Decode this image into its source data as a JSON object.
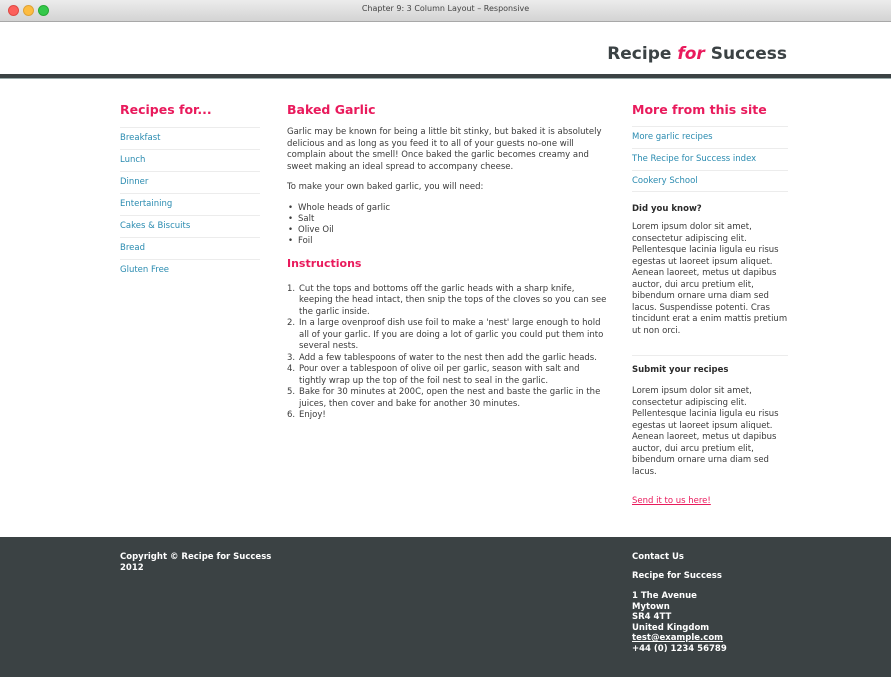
{
  "window": {
    "title": "Chapter 9: 3 Column Layout – Responsive"
  },
  "header": {
    "logo_part1": "Recipe ",
    "logo_part2": "for",
    "logo_part3": " Success"
  },
  "left": {
    "heading": "Recipes for...",
    "items": [
      "Breakfast",
      "Lunch",
      "Dinner",
      "Entertaining",
      "Cakes & Biscuits",
      "Bread",
      "Gluten Free"
    ]
  },
  "main": {
    "title": "Baked Garlic",
    "intro": "Garlic may be known for being a little bit stinky, but baked it is absolutely delicious and as long as you feed it to all of your guests no-one will complain about the smell! Once baked the garlic becomes creamy and sweet making an ideal spread to accompany cheese.",
    "need": "To make your own baked garlic, you will need:",
    "ingredients": [
      "Whole heads of garlic",
      "Salt",
      "Olive Oil",
      "Foil"
    ],
    "instructions_heading": "Instructions",
    "steps": [
      "Cut the tops and bottoms off the garlic heads with a sharp knife, keeping the head intact, then snip the tops of the cloves so you can see the garlic inside.",
      "In a large ovenproof dish use foil to make a 'nest' large enough to hold all of your garlic. If you are doing a lot of garlic you could put them into several nests.",
      "Add a few tablespoons of water to the nest then add the garlic heads.",
      "Pour over a tablespoon of olive oil per garlic, season with salt and tightly wrap up the top of the foil nest to seal in the garlic.",
      "Bake for 30 minutes at 200C, open the nest and baste the garlic in the juices, then cover and bake for another 30 minutes.",
      "Enjoy!"
    ]
  },
  "right": {
    "heading": "More from this site",
    "links": [
      "More garlic recipes",
      "The Recipe for Success index",
      "Cookery School"
    ],
    "did_you_know_heading": "Did you know?",
    "did_you_know_text": "Lorem ipsum dolor sit amet, consectetur adipiscing elit. Pellentesque lacinia ligula eu risus egestas ut laoreet ipsum aliquet. Aenean laoreet, metus ut dapibus auctor, dui arcu pretium elit, bibendum ornare urna diam sed lacus. Suspendisse potenti. Cras tincidunt erat a enim mattis pretium ut non orci.",
    "submit_heading": "Submit your recipes",
    "submit_text": "Lorem ipsum dolor sit amet, consectetur adipiscing elit. Pellentesque lacinia ligula eu risus egestas ut laoreet ipsum aliquet. Aenean laoreet, metus ut dapibus auctor, dui arcu pretium elit, bibendum ornare urna diam sed lacus.",
    "send_link": "Send it to us here!"
  },
  "footer": {
    "copyright": "Copyright © Recipe for Success 2012",
    "contact_heading": "Contact Us",
    "company": "Recipe for Success",
    "address": [
      "1 The Avenue",
      "Mytown",
      "SR4 4TT",
      "United Kingdom"
    ],
    "email": "test@example.com",
    "phone": "+44 (0) 1234 56789"
  }
}
